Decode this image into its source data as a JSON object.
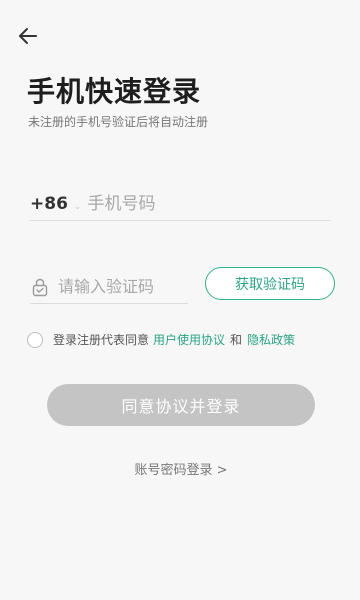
{
  "header": {
    "back_icon": "arrow-left-icon",
    "title": "手机快速登录",
    "subtitle": "未注册的手机号验证后将自动注册"
  },
  "phone": {
    "country_code": "+86",
    "separator": "⌄",
    "placeholder": "手机号码",
    "value": ""
  },
  "code": {
    "icon": "lock-icon",
    "placeholder": "请输入验证码",
    "value": "",
    "get_code_label": "获取验证码"
  },
  "agreement": {
    "checked": false,
    "prefix": "登录注册代表同意",
    "user_agreement": "用户使用协议",
    "and": "和",
    "privacy_policy": "隐私政策"
  },
  "actions": {
    "login_label": "同意协议并登录",
    "password_login_label": "账号密码登录 >"
  },
  "colors": {
    "accent": "#2aa786",
    "button_disabled": "#c4c4c4",
    "background": "#f7f7f7"
  }
}
